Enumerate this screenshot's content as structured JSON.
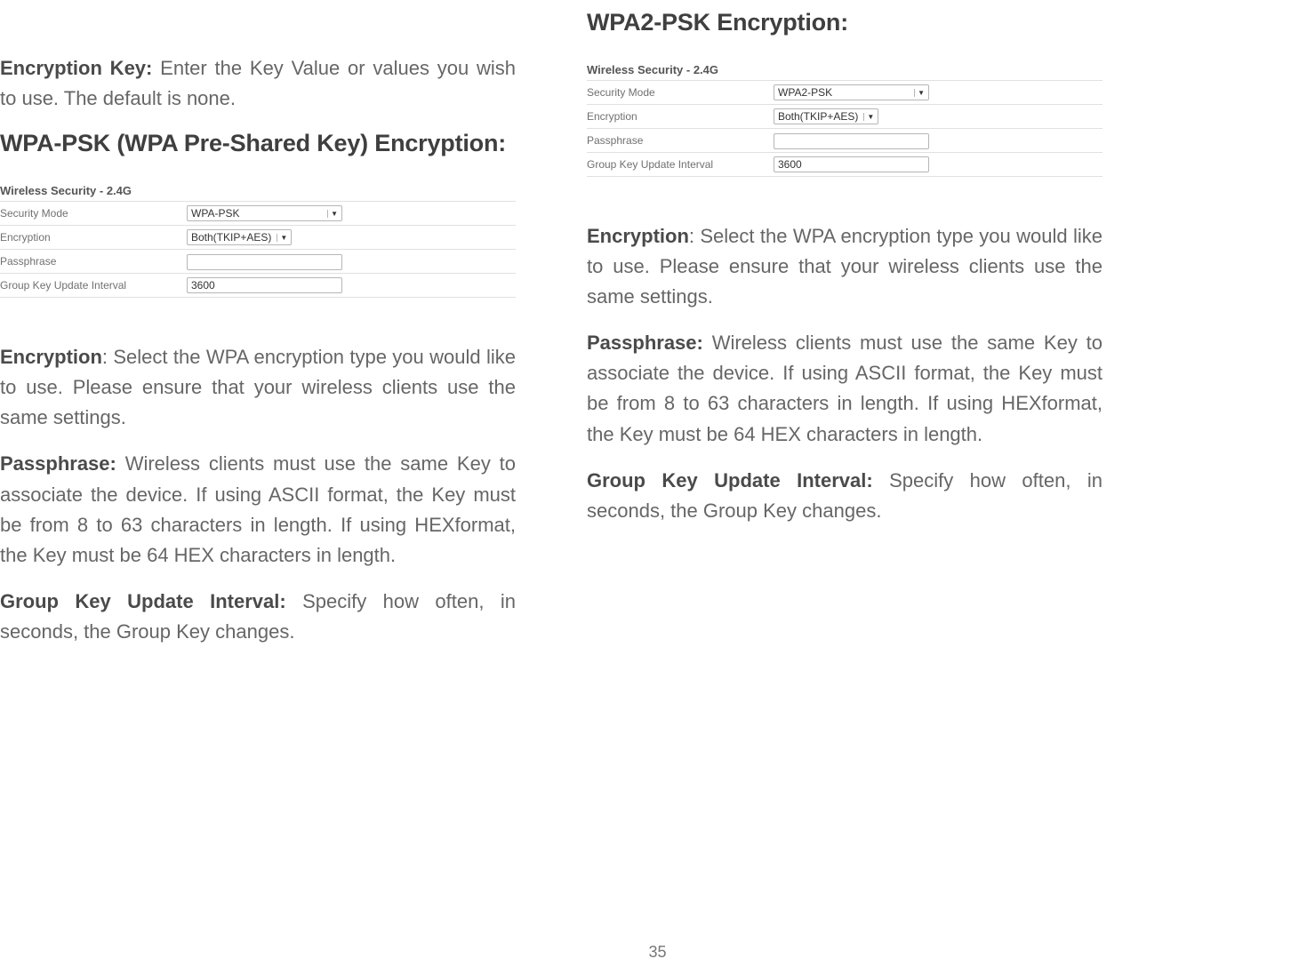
{
  "leftColumn": {
    "introPara": {
      "label": "Encryption Key:",
      "text": " Enter the Key Value or values you wish to use. The default is none."
    },
    "heading": "WPA-PSK (WPA Pre-Shared Key) Encryption:",
    "screenshot": {
      "title": "Wireless Security - 2.4G",
      "rows": {
        "securityMode": {
          "label": "Security Mode",
          "value": "WPA-PSK"
        },
        "encryption": {
          "label": "Encryption",
          "value": "Both(TKIP+AES)"
        },
        "passphrase": {
          "label": "Passphrase",
          "value": ""
        },
        "interval": {
          "label": "Group Key Update Interval",
          "value": "3600"
        }
      }
    },
    "paras": {
      "p1": {
        "label": "Encryption",
        "text": ": Select the WPA encryption type you would like to use. Please ensure that your wireless clients use the same settings."
      },
      "p2": {
        "label": "Passphrase:",
        "text": " Wireless clients must use the same Key to associate the device. If using ASCII format, the Key must be from 8 to 63 characters in length. If using HEXformat, the Key must be 64 HEX characters in length."
      },
      "p3": {
        "label": "Group Key Update Interval:",
        "text": " Specify how often, in seconds, the Group Key changes."
      }
    }
  },
  "rightColumn": {
    "heading": "WPA2-PSK Encryption:",
    "screenshot": {
      "title": "Wireless Security - 2.4G",
      "rows": {
        "securityMode": {
          "label": "Security Mode",
          "value": "WPA2-PSK"
        },
        "encryption": {
          "label": "Encryption",
          "value": "Both(TKIP+AES)"
        },
        "passphrase": {
          "label": "Passphrase",
          "value": ""
        },
        "interval": {
          "label": "Group Key Update Interval",
          "value": "3600"
        }
      }
    },
    "paras": {
      "p1": {
        "label": "Encryption",
        "text": ": Select the WPA encryption type you would like to use. Please ensure that your wireless clients use the same settings."
      },
      "p2": {
        "label": "Passphrase:",
        "text": " Wireless clients must use the same Key to associate the device. If using ASCII format, the Key must be from 8 to 63 characters in length. If using HEXformat, the Key must be 64 HEX characters in length."
      },
      "p3": {
        "label": "Group Key Update Interval:",
        "text": " Specify how often, in seconds, the Group Key changes."
      }
    }
  },
  "pageNumber": "35"
}
